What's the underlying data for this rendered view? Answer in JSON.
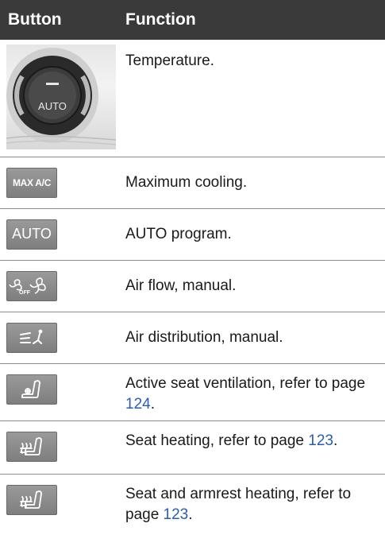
{
  "header": {
    "col1": "Button",
    "col2": "Function"
  },
  "rows": [
    {
      "icon": "temperature-knob",
      "icon_text": "AUTO",
      "text": "Temperature."
    },
    {
      "icon": "max-ac-button",
      "icon_text": "MAX A/C",
      "text": "Maximum cooling."
    },
    {
      "icon": "auto-button",
      "icon_text": "AUTO",
      "text": "AUTO program."
    },
    {
      "icon": "fan-off-fan-icon",
      "icon_text": "OFF",
      "text": "Air flow, manual."
    },
    {
      "icon": "air-distribution-icon",
      "text": "Air distribution, manual."
    },
    {
      "icon": "seat-ventilation-icon",
      "text_before": "Active seat ventilation, refer to page ",
      "link": "124",
      "text_after": "."
    },
    {
      "icon": "seat-heating-icon",
      "text_before": "Seat heating, refer to page ",
      "link": "123",
      "text_after": "."
    },
    {
      "icon": "seat-armrest-heating-icon",
      "text_before": "Seat and armrest heating, refer to page ",
      "link": "123",
      "text_after": "."
    }
  ]
}
